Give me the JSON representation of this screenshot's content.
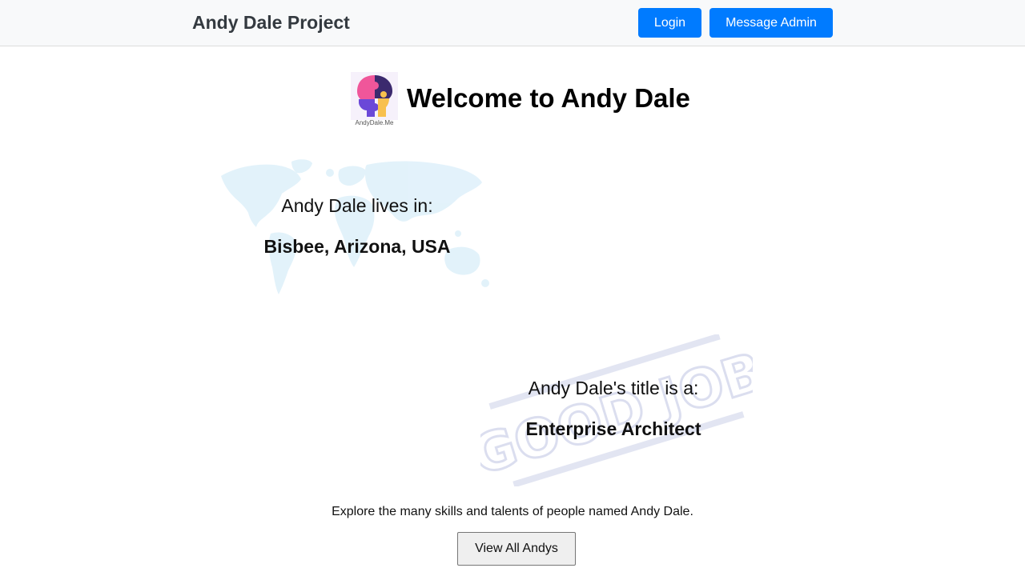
{
  "navbar": {
    "brand": "Andy Dale Project",
    "login_label": "Login",
    "message_admin_label": "Message Admin",
    "accent_color": "#007bff"
  },
  "hero": {
    "logo_caption": "AndyDale.Me",
    "title": "Welcome to Andy Dale"
  },
  "location": {
    "label": "Andy Dale lives in:",
    "value": "Bisbee, Arizona, USA"
  },
  "job_title": {
    "label": "Andy Dale's title is a:",
    "value": "Enterprise Architect",
    "stamp_text": "GOOD JOB"
  },
  "explore": {
    "text": "Explore the many skills and talents of people named Andy Dale.",
    "button_label": "View All Andys"
  }
}
